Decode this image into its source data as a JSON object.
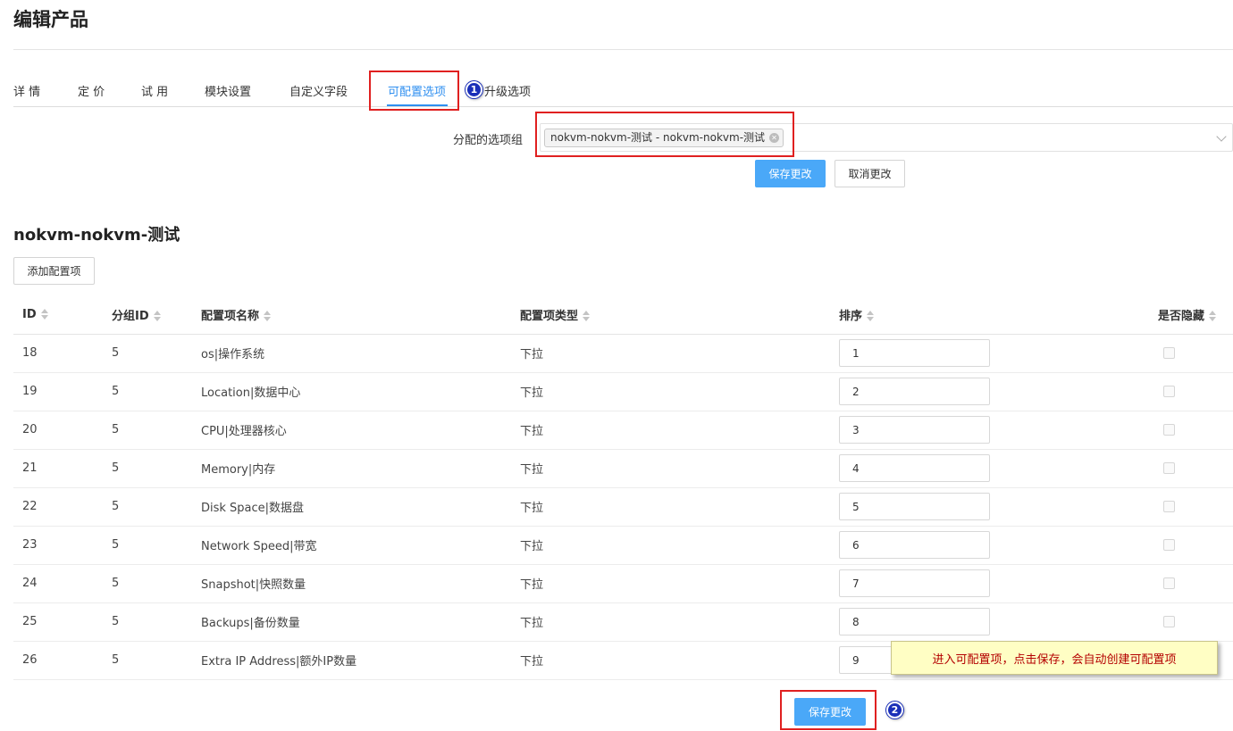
{
  "page": {
    "title": "编辑产品"
  },
  "tabs": [
    {
      "label": "详 情"
    },
    {
      "label": "定 价"
    },
    {
      "label": "试 用"
    },
    {
      "label": "模块设置"
    },
    {
      "label": "自定义字段"
    },
    {
      "label": "可配置选项",
      "active": true
    },
    {
      "label": "升级选项"
    }
  ],
  "assign": {
    "label": "分配的选项组",
    "selected_chip": "nokvm-nokvm-测试 - nokvm-nokvm-测试",
    "save_label": "保存更改",
    "cancel_label": "取消更改"
  },
  "group": {
    "title": "nokvm-nokvm-测试",
    "add_button": "添加配置项"
  },
  "table": {
    "headers": [
      "ID",
      "分组ID",
      "配置项名称",
      "配置项类型",
      "排序",
      "是否隐藏"
    ],
    "rows": [
      {
        "id": "18",
        "gid": "5",
        "name": "os|操作系统",
        "type": "下拉",
        "order": "1",
        "hidden": false
      },
      {
        "id": "19",
        "gid": "5",
        "name": "Location|数据中心",
        "type": "下拉",
        "order": "2",
        "hidden": false
      },
      {
        "id": "20",
        "gid": "5",
        "name": "CPU|处理器核心",
        "type": "下拉",
        "order": "3",
        "hidden": false
      },
      {
        "id": "21",
        "gid": "5",
        "name": "Memory|内存",
        "type": "下拉",
        "order": "4",
        "hidden": false
      },
      {
        "id": "22",
        "gid": "5",
        "name": "Disk Space|数据盘",
        "type": "下拉",
        "order": "5",
        "hidden": false
      },
      {
        "id": "23",
        "gid": "5",
        "name": "Network Speed|带宽",
        "type": "下拉",
        "order": "6",
        "hidden": false
      },
      {
        "id": "24",
        "gid": "5",
        "name": "Snapshot|快照数量",
        "type": "下拉",
        "order": "7",
        "hidden": false
      },
      {
        "id": "25",
        "gid": "5",
        "name": "Backups|备份数量",
        "type": "下拉",
        "order": "8",
        "hidden": false
      },
      {
        "id": "26",
        "gid": "5",
        "name": "Extra IP Address|额外IP数量",
        "type": "下拉",
        "order": "9",
        "hidden": false
      }
    ]
  },
  "footer": {
    "save_label": "保存更改"
  },
  "annotations": {
    "badge1": "1",
    "badge2": "2",
    "note": "进入可配置项，点击保存，会自动创建可配置项",
    "highlight_color": "#e02020",
    "badge_color": "#1a2fb8",
    "note_text_color": "#b40000"
  },
  "colors": {
    "accent": "#2f8ff0",
    "primary_button": "#4aa8f8"
  },
  "icons": {
    "chip_remove": "close-icon",
    "select_arrow": "chevron-down-icon",
    "sort": "sort-icon"
  }
}
